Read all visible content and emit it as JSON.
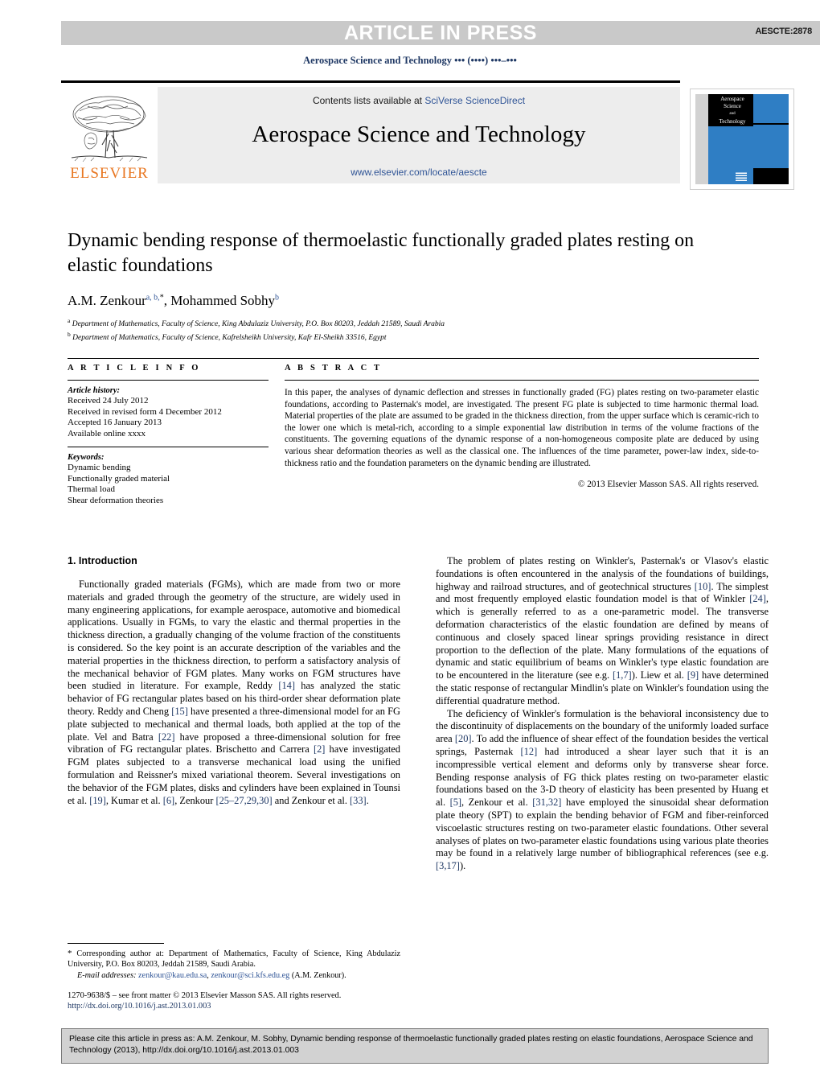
{
  "banner": {
    "status_text": "ARTICLE IN PRESS",
    "article_code": "AESCTE:2878",
    "running_head": "Aerospace Science and Technology ••• (••••) •••–•••"
  },
  "masthead": {
    "contents_prefix": "Contents lists available at ",
    "contents_link": "SciVerse ScienceDirect",
    "journal_title": "Aerospace Science and Technology",
    "journal_url": "www.elsevier.com/locate/aescte",
    "publisher_wordmark": "ELSEVIER",
    "cover_title_line1": "Aerospace",
    "cover_title_line2": "Science",
    "cover_title_and": "and",
    "cover_title_line3": "Technology"
  },
  "article": {
    "title": "Dynamic bending response of thermoelastic functionally graded plates resting on elastic foundations",
    "authors_part1": "A.M. Zenkour",
    "authors_sup1": "a, b,",
    "authors_star": "*",
    "authors_part2": ", Mohammed Sobhy",
    "authors_sup2": "b",
    "affiliations": [
      {
        "marker": "a",
        "text": "Department of Mathematics, Faculty of Science, King Abdulaziz University, P.O. Box 80203, Jeddah 21589, Saudi Arabia"
      },
      {
        "marker": "b",
        "text": "Department of Mathematics, Faculty of Science, Kafrelsheikh University, Kafr El-Sheikh 33516, Egypt"
      }
    ]
  },
  "info": {
    "heading": "A R T I C L E    I N F O",
    "history_label": "Article history:",
    "history": [
      "Received 24 July 2012",
      "Received in revised form 4 December 2012",
      "Accepted 16 January 2013",
      "Available online xxxx"
    ],
    "keywords_label": "Keywords:",
    "keywords": [
      "Dynamic bending",
      "Functionally graded material",
      "Thermal load",
      "Shear deformation theories"
    ]
  },
  "abstract": {
    "heading": "A B S T R A C T",
    "text": "In this paper, the analyses of dynamic deflection and stresses in functionally graded (FG) plates resting on two-parameter elastic foundations, according to Pasternak's model, are investigated. The present FG plate is subjected to time harmonic thermal load. Material properties of the plate are assumed to be graded in the thickness direction, from the upper surface which is ceramic-rich to the lower one which is metal-rich, according to a simple exponential law distribution in terms of the volume fractions of the constituents. The governing equations of the dynamic response of a non-homogeneous composite plate are deduced by using various shear deformation theories as well as the classical one. The influences of the time parameter, power-law index, side-to-thickness ratio and the foundation parameters on the dynamic bending are illustrated.",
    "copyright": "© 2013 Elsevier Masson SAS. All rights reserved."
  },
  "body": {
    "section_title": "1. Introduction",
    "left_paragraphs": [
      "Functionally graded materials (FGMs), which are made from two or more materials and graded through the geometry of the structure, are widely used in many engineering applications, for example aerospace, automotive and biomedical applications. Usually in FGMs, to vary the elastic and thermal properties in the thickness direction, a gradually changing of the volume fraction of the constituents is considered. So the key point is an accurate description of the variables and the material properties in the thickness direction, to perform a satisfactory analysis of the mechanical behavior of FGM plates. Many works on FGM structures have been studied in literature. For example, Reddy [14] has analyzed the static behavior of FG rectangular plates based on his third-order shear deformation plate theory. Reddy and Cheng [15] have presented a three-dimensional model for an FG plate subjected to mechanical and thermal loads, both applied at the top of the plate. Vel and Batra [22] have proposed a three-dimensional solution for free vibration of FG rectangular plates. Brischetto and Carrera [2] have investigated FGM plates subjected to a transverse mechanical load using the unified formulation and Reissner's mixed variational theorem. Several investigations on the behavior of the FGM plates, disks and cylinders have been explained in Tounsi et al. [19], Kumar et al. [6], Zenkour [25–27,29,30] and Zenkour et al. [33]."
    ],
    "right_paragraphs": [
      "The problem of plates resting on Winkler's, Pasternak's or Vlasov's elastic foundations is often encountered in the analysis of the foundations of buildings, highway and railroad structures, and of geotechnical structures [10]. The simplest and most frequently employed elastic foundation model is that of Winkler [24], which is generally referred to as a one-parametric model. The transverse deformation characteristics of the elastic foundation are defined by means of continuous and closely spaced linear springs providing resistance in direct proportion to the deflection of the plate. Many formulations of the equations of dynamic and static equilibrium of beams on Winkler's type elastic foundation are to be encountered in the literature (see e.g. [1,7]). Liew et al. [9] have determined the static response of rectangular Mindlin's plate on Winkler's foundation using the differential quadrature method.",
      "The deficiency of Winkler's formulation is the behavioral inconsistency due to the discontinuity of displacements on the boundary of the uniformly loaded surface area [20]. To add the influence of shear effect of the foundation besides the vertical springs, Pasternak [12] had introduced a shear layer such that it is an incompressible vertical element and deforms only by transverse shear force. Bending response analysis of FG thick plates resting on two-parameter elastic foundations based on the 3-D theory of elasticity has been presented by Huang et al. [5], Zenkour et al. [31,32] have employed the sinusoidal shear deformation plate theory (SPT) to explain the bending behavior of FGM and fiber-reinforced viscoelastic structures resting on two-parameter elastic foundations. Other several analyses of plates on two-parameter elastic foundations using various plate theories may be found in a relatively large number of bibliographical references (see e.g. [3,17])."
    ]
  },
  "footnote": {
    "corresponding": "Corresponding author at: Department of Mathematics, Faculty of Science, King Abdulaziz University, P.O. Box 80203, Jeddah 21589, Saudi Arabia.",
    "email_label": "E-mail addresses:",
    "email1": "zenkour@kau.edu.sa",
    "email2": "zenkour@sci.kfs.edu.eg",
    "email_attrib": "(A.M. Zenkour).",
    "issn_line": "1270-9638/$ – see front matter © 2013 Elsevier Masson SAS. All rights reserved.",
    "doi_line": "http://dx.doi.org/10.1016/j.ast.2013.01.003"
  },
  "cite_box": {
    "text": "Please cite this article in press as: A.M. Zenkour, M. Sobhy, Dynamic bending response of thermoelastic functionally graded plates resting on elastic foundations, Aerospace Science and Technology (2013), http://dx.doi.org/10.1016/j.ast.2013.01.003"
  },
  "colors": {
    "banner_gray": "#c9c9c9",
    "link_blue": "#2f5496",
    "ref_blue": "#1f3864",
    "elsevier_orange": "#E87722",
    "cover_blue": "#2f7ec4",
    "cite_gray": "#d2d2d2"
  }
}
